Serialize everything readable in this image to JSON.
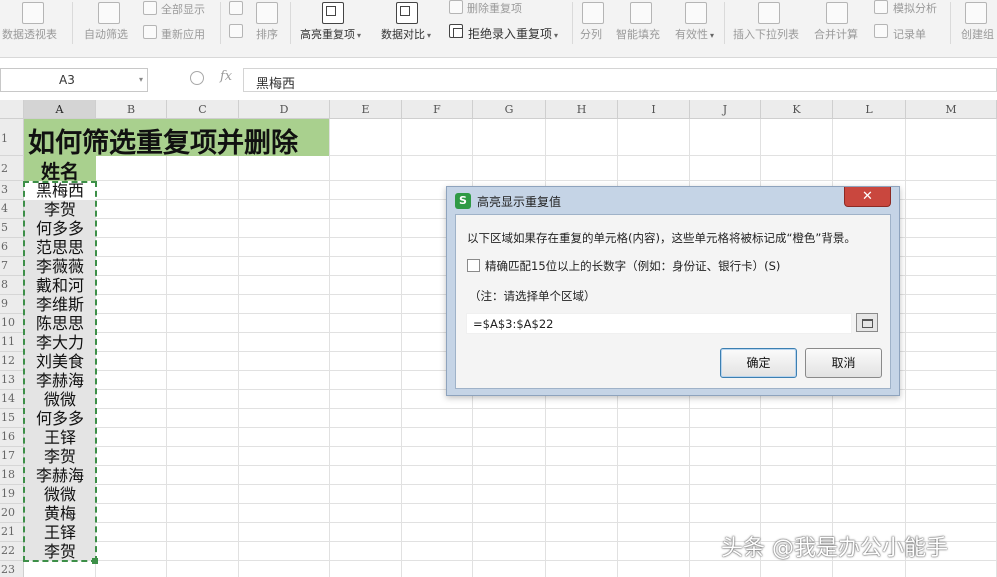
{
  "ribbon": {
    "items": [
      {
        "label": "数据透视表"
      },
      {
        "label": "自动筛选"
      },
      {
        "label": "全部显示"
      },
      {
        "label": "重新应用"
      },
      {
        "label": "排序"
      },
      {
        "label": "高亮重复项"
      },
      {
        "label": "数据对比"
      },
      {
        "label": "删除重复项"
      },
      {
        "label": "拒绝录入重复项"
      },
      {
        "label": "分列"
      },
      {
        "label": "智能填充"
      },
      {
        "label": "有效性"
      },
      {
        "label": "插入下拉列表"
      },
      {
        "label": "合并计算"
      },
      {
        "label": "模拟分析"
      },
      {
        "label": "记录单"
      },
      {
        "label": "创建组"
      }
    ]
  },
  "formula_bar": {
    "name_box": "A3",
    "fx_label": "fx",
    "content": "黑梅西"
  },
  "sheet": {
    "columns": [
      "A",
      "B",
      "C",
      "D",
      "E",
      "F",
      "G",
      "H",
      "I",
      "J",
      "K",
      "L",
      "M"
    ],
    "rows": [
      "1",
      "2",
      "3",
      "4",
      "5",
      "6",
      "7",
      "8",
      "9",
      "10",
      "11",
      "12",
      "13",
      "14",
      "15",
      "16",
      "17",
      "18",
      "19",
      "20",
      "21",
      "22",
      "23"
    ],
    "title": "如何筛选重复项并删除",
    "header": "姓名",
    "names": [
      "黑梅西",
      "李贺",
      "何多多",
      "范思思",
      "李薇薇",
      "戴和河",
      "李维斯",
      "陈思思",
      "李大力",
      "刘美食",
      "李赫海",
      "微微",
      "何多多",
      "王铎",
      "李贺",
      "李赫海",
      "微微",
      "黄梅",
      "王铎",
      "李贺"
    ]
  },
  "dialog": {
    "title": "高亮显示重复值",
    "close_label": "✕",
    "description": "以下区域如果存在重复的单元格(内容)，这些单元格将被标记成“橙色”背景。",
    "checkbox_label": "精确匹配15位以上的长数字（例如：身份证、银行卡）(S)",
    "note": "（注：请选择单个区域）",
    "range": "=$A$3:$A$22",
    "ok_label": "确定",
    "cancel_label": "取消"
  },
  "watermark": "头条 @我是办公小能手",
  "colors": {
    "title_fill": "#a9d08e",
    "selection_border": "#3d8f48",
    "close_button": "#c9473e"
  }
}
